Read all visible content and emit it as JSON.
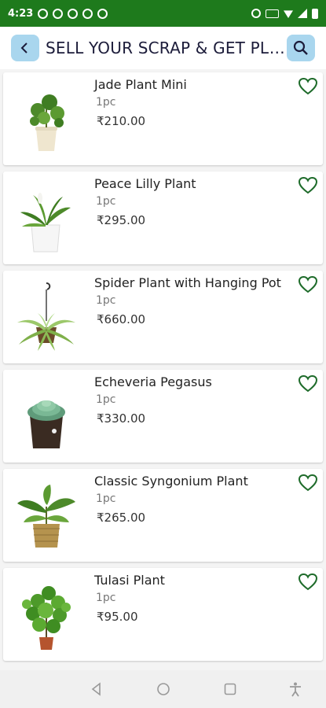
{
  "status_bar": {
    "time": "4:23",
    "notification_icons": [
      "whatsapp-icon",
      "whatsapp-icon",
      "facebook-icon",
      "facebook-icon",
      "facebook-icon"
    ],
    "system_icons": [
      "alarm-icon",
      "volte-icon",
      "wifi-icon",
      "signal-icon",
      "battery-icon"
    ]
  },
  "app_bar": {
    "back_icon": "chevron-left-icon",
    "title": "SELL YOUR SCRAP & GET PLA...",
    "search_icon": "search-icon"
  },
  "colors": {
    "status_bar": "#1e7a1c",
    "accent_button": "#a9d6ee",
    "heart": "#1e6b2a"
  },
  "products": [
    {
      "name": "Jade Plant Mini",
      "qty": "1pc",
      "price": "₹210.00",
      "image_icon": "jade-plant-image"
    },
    {
      "name": "Peace Lilly Plant",
      "qty": "1pc",
      "price": "₹295.00",
      "image_icon": "peace-lily-image"
    },
    {
      "name": "Spider Plant with Hanging Pot",
      "qty": "1pc",
      "price": "₹660.00",
      "image_icon": "spider-plant-image"
    },
    {
      "name": "Echeveria Pegasus",
      "qty": "1pc",
      "price": "₹330.00",
      "image_icon": "echeveria-image"
    },
    {
      "name": "Classic Syngonium Plant",
      "qty": "1pc",
      "price": "₹265.00",
      "image_icon": "syngonium-image"
    },
    {
      "name": "Tulasi Plant",
      "qty": "1pc",
      "price": "₹95.00",
      "image_icon": "tulasi-image"
    }
  ],
  "nav_bar": [
    "back-nav-icon",
    "home-nav-icon",
    "recents-nav-icon",
    "accessibility-icon"
  ]
}
